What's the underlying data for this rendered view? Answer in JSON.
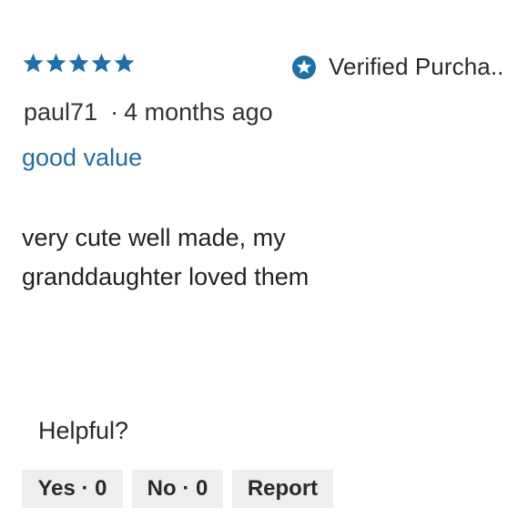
{
  "rating": {
    "value": 5,
    "max": 5,
    "star_color": "#1f6fa8",
    "icon": "star-icon"
  },
  "verified": {
    "icon": "verified-badge-icon",
    "icon_color": "#1f6fa8",
    "label": "Verified Purcha.."
  },
  "byline": {
    "author": "paul71",
    "separator": "·",
    "time_ago": "4 months ago"
  },
  "review": {
    "title": "good value",
    "title_color": "#1f6f9f",
    "body_lines": [
      "very cute well made, my",
      "granddaughter loved them"
    ]
  },
  "helpful": {
    "label": "Helpful?",
    "yes_label": "Yes · 0",
    "no_label": "No · 0",
    "report_label": "Report"
  }
}
